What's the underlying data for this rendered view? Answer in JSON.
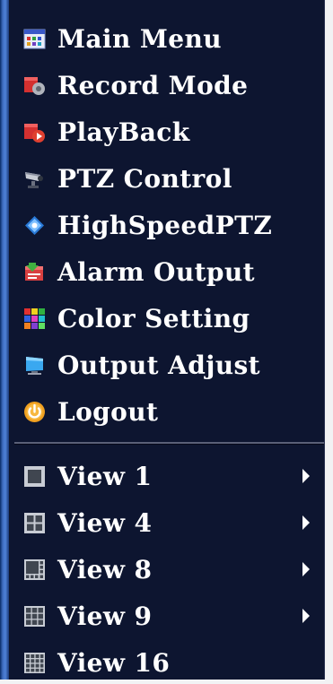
{
  "menu": {
    "items": [
      {
        "label": "Main Menu",
        "icon": "main-menu-icon"
      },
      {
        "label": "Record Mode",
        "icon": "record-mode-icon"
      },
      {
        "label": "PlayBack",
        "icon": "playback-icon"
      },
      {
        "label": "PTZ Control",
        "icon": "ptz-camera-icon"
      },
      {
        "label": "HighSpeedPTZ",
        "icon": "highspeed-ptz-icon"
      },
      {
        "label": "Alarm Output",
        "icon": "alarm-output-icon"
      },
      {
        "label": "Color Setting",
        "icon": "color-grid-icon"
      },
      {
        "label": "Output Adjust",
        "icon": "monitor-icon"
      },
      {
        "label": "Logout",
        "icon": "power-icon"
      }
    ],
    "views": [
      {
        "label": "View 1",
        "icon": "single-view-icon",
        "submenu": true
      },
      {
        "label": "View 4",
        "icon": "quad-view-icon",
        "submenu": true
      },
      {
        "label": "View 8",
        "icon": "eight-view-icon",
        "submenu": true
      },
      {
        "label": "View 9",
        "icon": "nine-view-icon",
        "submenu": true
      },
      {
        "label": "View 16",
        "icon": "sixteen-view-icon",
        "submenu": false
      }
    ]
  }
}
